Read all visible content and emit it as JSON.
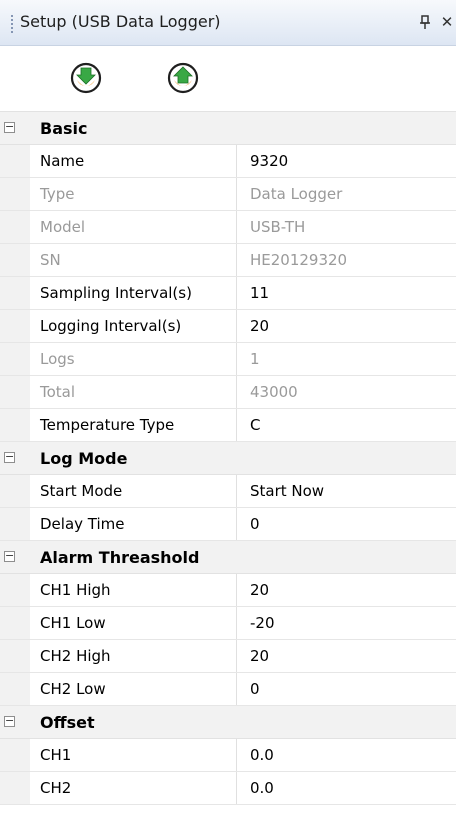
{
  "window": {
    "title": "Setup (USB Data Logger)",
    "pin_glyph": "\u0002",
    "close_glyph": "✕"
  },
  "toolbar": {
    "buttons": [
      {
        "icon": "download-arrow-icon",
        "color": "#2e9f3a"
      },
      {
        "icon": "upload-arrow-icon",
        "color": "#2e9f3a"
      }
    ]
  },
  "colors": {
    "category_bg": "#f2f2f2",
    "readonly_text": "#9a9a9a",
    "icon_orange": "#f39a2c",
    "icon_green": "#39a845"
  },
  "categories": [
    {
      "label": "Basic",
      "toggle": "−",
      "props": [
        {
          "name": "Name",
          "value": "9320",
          "readonly": false
        },
        {
          "name": "Type",
          "value": "Data Logger",
          "readonly": true
        },
        {
          "name": "Model",
          "value": "USB-TH",
          "readonly": true
        },
        {
          "name": "SN",
          "value": "HE20129320",
          "readonly": true
        },
        {
          "name": "Sampling Interval(s)",
          "value": "11",
          "readonly": false
        },
        {
          "name": "Logging Interval(s)",
          "value": "20",
          "readonly": false
        },
        {
          "name": "Logs",
          "value": "1",
          "readonly": true
        },
        {
          "name": "Total",
          "value": "43000",
          "readonly": true
        },
        {
          "name": "Temperature Type",
          "value": "C",
          "readonly": false
        }
      ]
    },
    {
      "label": "Log Mode",
      "toggle": "−",
      "props": [
        {
          "name": "Start Mode",
          "value": "Start Now",
          "readonly": false
        },
        {
          "name": "Delay Time",
          "value": "0",
          "readonly": false
        }
      ]
    },
    {
      "label": "Alarm Threashold",
      "toggle": "−",
      "props": [
        {
          "name": "CH1 High",
          "value": "20",
          "readonly": false
        },
        {
          "name": "CH1 Low",
          "value": "-20",
          "readonly": false
        },
        {
          "name": "CH2 High",
          "value": "20",
          "readonly": false
        },
        {
          "name": "CH2 Low",
          "value": "0",
          "readonly": false
        }
      ]
    },
    {
      "label": "Offset",
      "toggle": "−",
      "props": [
        {
          "name": "CH1",
          "value": "0.0",
          "readonly": false
        },
        {
          "name": "CH2",
          "value": "0.0",
          "readonly": false
        }
      ]
    }
  ]
}
